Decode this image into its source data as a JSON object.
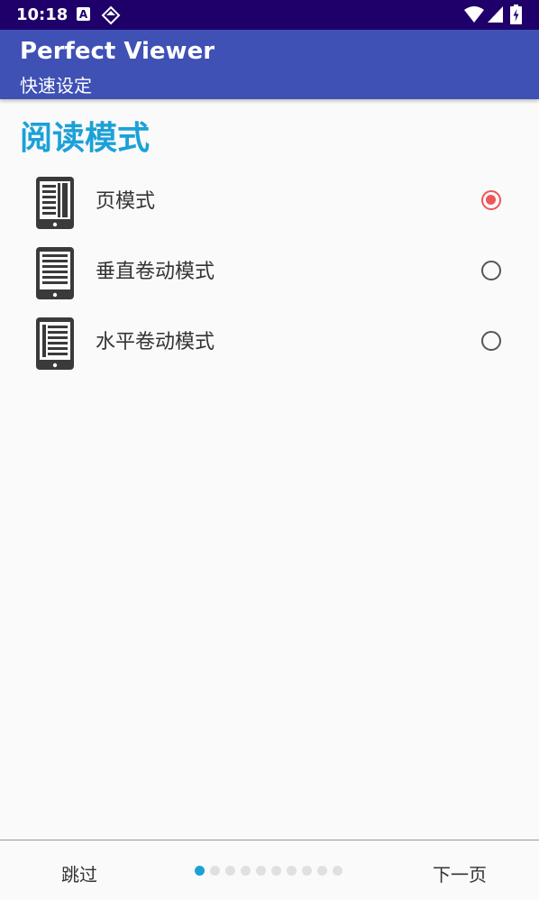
{
  "status_bar": {
    "time": "10:18",
    "notif_icon_letter": "A",
    "icons": [
      "a-notification-icon",
      "diamond-icon",
      "wifi-icon",
      "signal-icon",
      "battery-charging-icon"
    ]
  },
  "app_bar": {
    "title": "Perfect Viewer",
    "subtitle": "快速设定",
    "color": "#3f51b5"
  },
  "section": {
    "title": "阅读模式",
    "title_color": "#1ba1d8"
  },
  "options": [
    {
      "label": "页模式",
      "icon": "page-mode-icon",
      "selected": true
    },
    {
      "label": "垂直卷动模式",
      "icon": "vertical-scroll-mode-icon",
      "selected": false
    },
    {
      "label": "水平卷动模式",
      "icon": "horizontal-scroll-mode-icon",
      "selected": false
    }
  ],
  "bottom_bar": {
    "skip_label": "跳过",
    "next_label": "下一页",
    "page_count": 10,
    "current_page": 1
  },
  "colors": {
    "status_bar": "#1f006b",
    "radio_selected": "#f0555a",
    "accent": "#1ba1d8"
  }
}
